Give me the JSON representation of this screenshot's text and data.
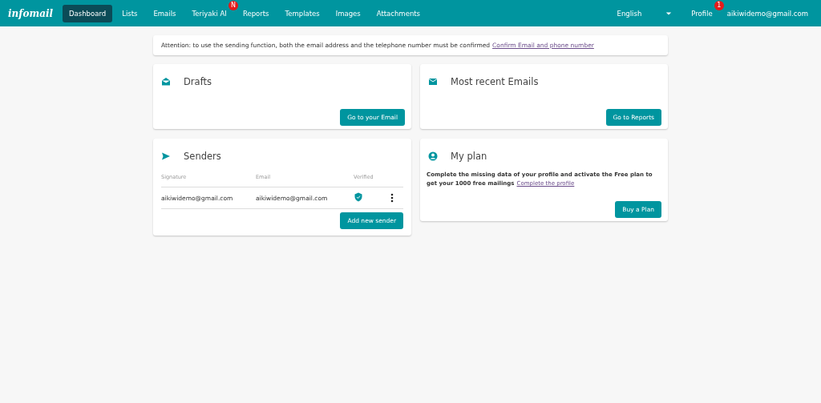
{
  "nav": {
    "logo": "infomail",
    "items": [
      {
        "label": "Dashboard",
        "selected": true
      },
      {
        "label": "Lists",
        "selected": false
      },
      {
        "label": "Emails",
        "selected": false
      },
      {
        "label": "Teriyaki AI",
        "selected": false,
        "badge": "N"
      },
      {
        "label": "Reports",
        "selected": false
      },
      {
        "label": "Templates",
        "selected": false
      },
      {
        "label": "Images",
        "selected": false
      },
      {
        "label": "Attachments",
        "selected": false
      }
    ],
    "language": "English",
    "profile": {
      "label": "Profile",
      "badge": "1"
    },
    "user": "aikiwidemo@gmail.com"
  },
  "notice": {
    "text": "Attention: to use the sending function, both the email address and the telephone number must be confirmed",
    "link": "Confirm Email and phone number"
  },
  "drafts": {
    "title": "Drafts",
    "button": "Go to your Email"
  },
  "senders": {
    "title": "Senders",
    "columns": [
      "Signature",
      "Email",
      "Verified"
    ],
    "rows": [
      {
        "signature": "aikiwidemo@gmail.com",
        "email": "aikiwidemo@gmail.com",
        "verified": true
      }
    ],
    "button": "Add new sender"
  },
  "recent": {
    "title": "Most recent Emails",
    "button": "Go to Reports"
  },
  "plan": {
    "title": "My plan",
    "text": "Complete the missing data of your profile and activate the Free plan to get your 1000 free mailings",
    "link": "Complete the profile",
    "button": "Buy a Plan"
  }
}
